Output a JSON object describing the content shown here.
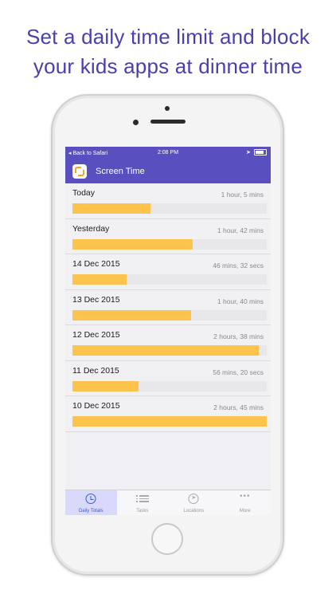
{
  "headline": {
    "line1": "Set a daily time limit and block",
    "line2": "your kids apps at dinner time"
  },
  "status_bar": {
    "back": "◂ Back to Safari",
    "time": "2:08 PM"
  },
  "nav": {
    "title": "Screen Time"
  },
  "rows": [
    {
      "label": "Today",
      "value": "1 hour, 5 mins",
      "fraction": 0.4
    },
    {
      "label": "Yesterday",
      "value": "1 hour, 42 mins",
      "fraction": 0.62
    },
    {
      "label": "14 Dec 2015",
      "value": "46 mins, 32 secs",
      "fraction": 0.28
    },
    {
      "label": "13 Dec 2015",
      "value": "1 hour, 40 mins",
      "fraction": 0.61
    },
    {
      "label": "12 Dec 2015",
      "value": "2 hours, 38 mins",
      "fraction": 0.96
    },
    {
      "label": "11 Dec 2015",
      "value": "56 mins, 20 secs",
      "fraction": 0.34
    },
    {
      "label": "10 Dec 2015",
      "value": "2 hours, 45 mins",
      "fraction": 1.0
    }
  ],
  "tabs": [
    {
      "label": "Daily Totals",
      "icon": "clock-icon",
      "active": true
    },
    {
      "label": "Tasks",
      "icon": "list-icon",
      "active": false
    },
    {
      "label": "Locations",
      "icon": "navigation-icon",
      "active": false
    },
    {
      "label": "More",
      "icon": "more-icon",
      "active": false
    }
  ],
  "colors": {
    "headline": "#4a3fb0",
    "nav_bar": "#5a4fbf",
    "bar_fill": "#fcc44c",
    "active_tab": "#3b5bdb"
  }
}
